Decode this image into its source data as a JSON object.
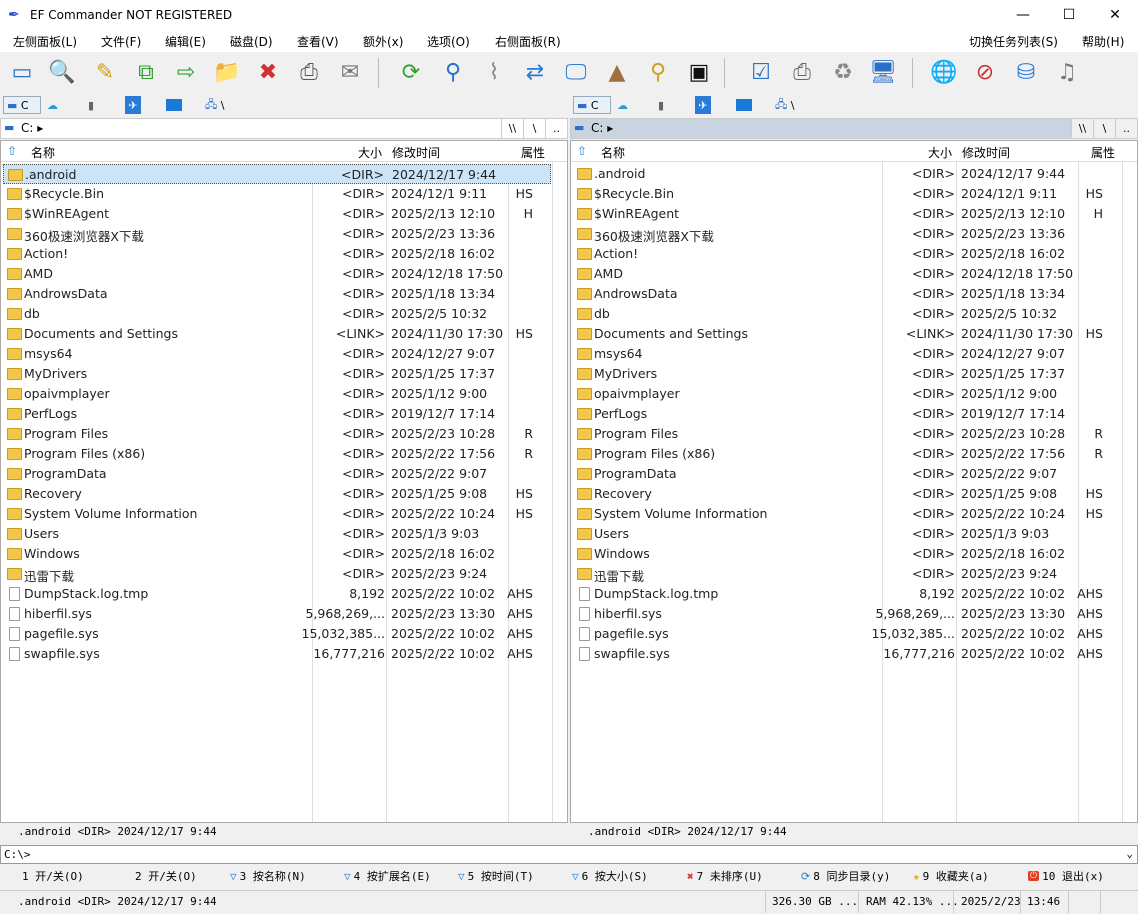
{
  "window": {
    "title": "EF Commander NOT REGISTERED",
    "minimize": "—",
    "maximize": "☐",
    "close": "✕"
  },
  "menu": [
    "左侧面板(L)",
    "文件(F)",
    "编辑(E)",
    "磁盘(D)",
    "查看(V)",
    "额外(x)",
    "选项(O)",
    "右侧面板(R)",
    "切换任务列表(S)",
    "帮助(H)"
  ],
  "toolbar": [
    "view-icon",
    "search-icon",
    "edit-icon",
    "copy-icon",
    "move-icon",
    "new-folder-icon",
    "delete-icon",
    "print-icon",
    "email-icon",
    "refresh-icon",
    "find-icon",
    "split-icon",
    "sync-icon",
    "monitor-icon",
    "pyramid-icon",
    "zoom-icon",
    "terminal-icon",
    "checklist-icon",
    "printer-icon",
    "recycle-icon",
    "display-icon",
    "network-icon",
    "stop-icon",
    "disk-icon",
    "music-icon"
  ],
  "drives": {
    "drive": "C",
    "net": "\\"
  },
  "left": {
    "path": "C:",
    "btn_root2": "\\\\",
    "btn_root": "\\",
    "btn_up": ".."
  },
  "right": {
    "path": "C:",
    "btn_root2": "\\\\",
    "btn_root": "\\",
    "btn_up": ".."
  },
  "columns": {
    "name": "名称",
    "size": "大小",
    "date": "修改时间",
    "attr": "属性"
  },
  "files": [
    {
      "name": ".android",
      "size": "<DIR>",
      "date": "2024/12/17  9:44",
      "attr": "",
      "type": "dir"
    },
    {
      "name": "$Recycle.Bin",
      "size": "<DIR>",
      "date": "2024/12/1  9:11",
      "attr": "HS",
      "type": "dir"
    },
    {
      "name": "$WinREAgent",
      "size": "<DIR>",
      "date": "2025/2/13  12:10",
      "attr": "H",
      "type": "dir"
    },
    {
      "name": "360极速浏览器X下载",
      "size": "<DIR>",
      "date": "2025/2/23  13:36",
      "attr": "",
      "type": "dir"
    },
    {
      "name": "Action!",
      "size": "<DIR>",
      "date": "2025/2/18  16:02",
      "attr": "",
      "type": "dir"
    },
    {
      "name": "AMD",
      "size": "<DIR>",
      "date": "2024/12/18  17:50",
      "attr": "",
      "type": "dir"
    },
    {
      "name": "AndrowsData",
      "size": "<DIR>",
      "date": "2025/1/18  13:34",
      "attr": "",
      "type": "dir"
    },
    {
      "name": "db",
      "size": "<DIR>",
      "date": "2025/2/5  10:32",
      "attr": "",
      "type": "dir"
    },
    {
      "name": "Documents and Settings",
      "size": "<LINK>",
      "date": "2024/11/30  17:30",
      "attr": "HS",
      "type": "link"
    },
    {
      "name": "msys64",
      "size": "<DIR>",
      "date": "2024/12/27  9:07",
      "attr": "",
      "type": "dir"
    },
    {
      "name": "MyDrivers",
      "size": "<DIR>",
      "date": "2025/1/25  17:37",
      "attr": "",
      "type": "dir"
    },
    {
      "name": "opaivmplayer",
      "size": "<DIR>",
      "date": "2025/1/12  9:00",
      "attr": "",
      "type": "dir"
    },
    {
      "name": "PerfLogs",
      "size": "<DIR>",
      "date": "2019/12/7  17:14",
      "attr": "",
      "type": "dir"
    },
    {
      "name": "Program Files",
      "size": "<DIR>",
      "date": "2025/2/23  10:28",
      "attr": "R",
      "type": "dir"
    },
    {
      "name": "Program Files (x86)",
      "size": "<DIR>",
      "date": "2025/2/22  17:56",
      "attr": "R",
      "type": "dir"
    },
    {
      "name": "ProgramData",
      "size": "<DIR>",
      "date": "2025/2/22  9:07",
      "attr": "",
      "type": "dir"
    },
    {
      "name": "Recovery",
      "size": "<DIR>",
      "date": "2025/1/25  9:08",
      "attr": "HS",
      "type": "dir"
    },
    {
      "name": "System Volume Information",
      "size": "<DIR>",
      "date": "2025/2/22  10:24",
      "attr": "HS",
      "type": "dir"
    },
    {
      "name": "Users",
      "size": "<DIR>",
      "date": "2025/1/3  9:03",
      "attr": "",
      "type": "dir"
    },
    {
      "name": "Windows",
      "size": "<DIR>",
      "date": "2025/2/18  16:02",
      "attr": "",
      "type": "dir"
    },
    {
      "name": "迅雷下载",
      "size": "<DIR>",
      "date": "2025/2/23  9:24",
      "attr": "",
      "type": "dir"
    },
    {
      "name": "DumpStack.log.tmp",
      "size": "8,192",
      "date": "2025/2/22  10:02",
      "attr": "AHS",
      "type": "file"
    },
    {
      "name": "hiberfil.sys",
      "size": "5,968,269,...",
      "date": "2025/2/23  13:30",
      "attr": "AHS",
      "type": "file"
    },
    {
      "name": "pagefile.sys",
      "size": "15,032,385...",
      "date": "2025/2/22  10:02",
      "attr": "AHS",
      "type": "file"
    },
    {
      "name": "swapfile.sys",
      "size": "16,777,216",
      "date": "2025/2/22  10:02",
      "attr": "AHS",
      "type": "file"
    }
  ],
  "panel_status": {
    "left": ".android    <DIR>  2024/12/17   9:44",
    "right": ".android    <DIR>  2024/12/17   9:44"
  },
  "cmdline": "C:\\>",
  "fkeys": [
    "1 开/关(O)",
    "2 开/关(O)",
    "3 按名称(N)",
    "4 按扩展名(E)",
    "5 按时间(T)",
    "6 按大小(S)",
    "7 未排序(U)",
    "8 同步目录(y)",
    "9 收藏夹(a)",
    "10 退出(x)"
  ],
  "statusbar": {
    "info": ".android    <DIR>  2024/12/17   9:44",
    "disk": "326.30 GB ...",
    "ram": "RAM 42.13% ...",
    "date": "2025/2/23",
    "time": "13:46"
  },
  "colors": {
    "selection": "#cce4f7",
    "folder": "#f3c74a"
  }
}
